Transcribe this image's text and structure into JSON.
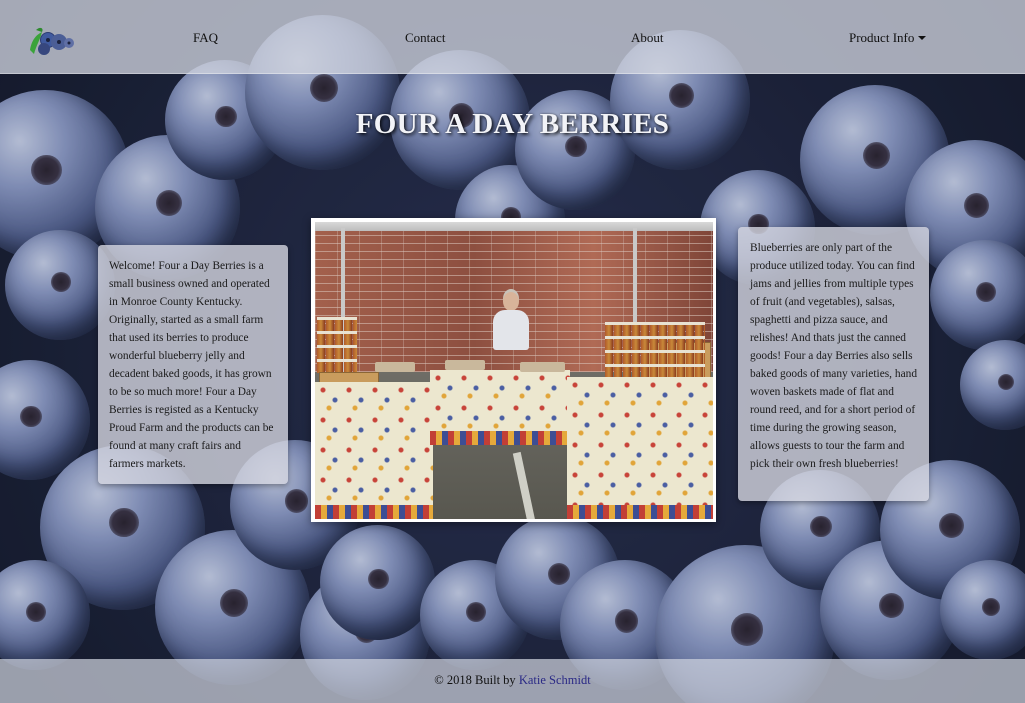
{
  "nav": {
    "logo_icon": "blueberries-logo-icon",
    "items": [
      {
        "label": "FAQ"
      },
      {
        "label": "Contact"
      },
      {
        "label": "About"
      },
      {
        "label": "Product Info",
        "dropdown": true
      }
    ]
  },
  "hero": {
    "title": "FOUR A DAY BERRIES"
  },
  "cards": {
    "left_text": "Welcome! Four a Day Berries is a small business owned and operated in Monroe County Kentucky. Originally, started as a small farm that used its berries to produce wonderful blueberry jelly and decadent baked goods, it has grown to be so much more! Four a Day Berries is registed as a Kentucky Proud Farm and the products can be found at many craft fairs and farmers markets.",
    "right_text": "Blueberries are only part of the produce utilized today. You can find jams and jellies from multiple types of fruit (and vegetables), salsas, spaghetti and pizza sauce, and relishes! And thats just the canned goods! Four a day Berries also sells baked goods of many varieties, hand woven baskets made of flat and round reed, and for a short period of time during the growing season, allows guests to tour the farm and pick their own fresh blueberries!"
  },
  "photo": {
    "subject": "farmers-market-booth-photo"
  },
  "footer": {
    "copyright": "© 2018 Built by ",
    "author": "Katie Schmidt"
  },
  "colors": {
    "nav_bg": "#ced2de",
    "footer_link": "#2b2a86",
    "title_text": "#f2f3f7"
  }
}
